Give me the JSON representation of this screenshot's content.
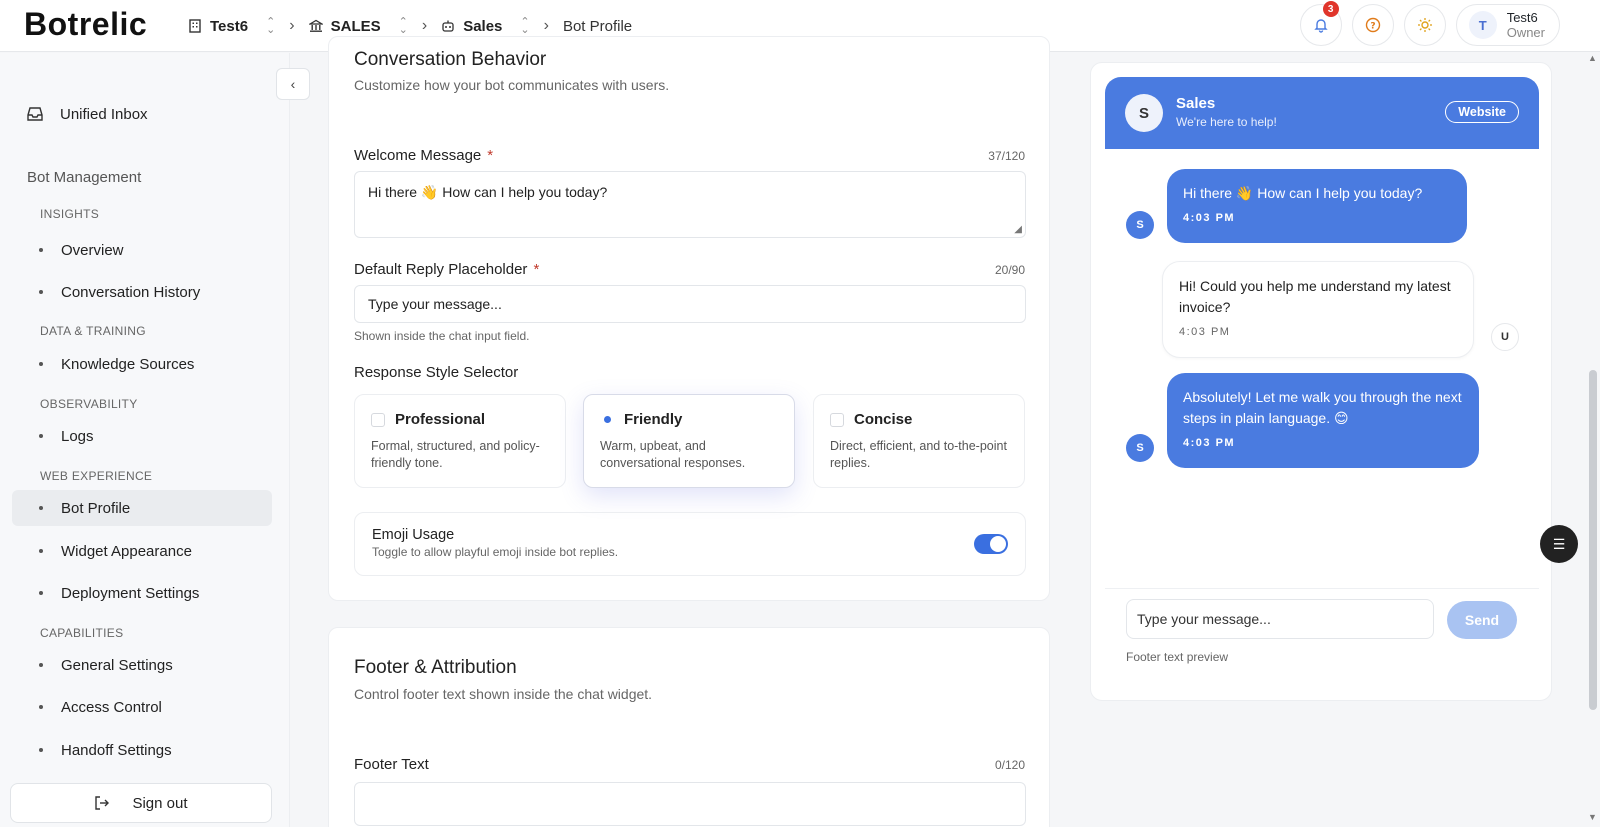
{
  "app": {
    "logo": "Botrelic"
  },
  "breadcrumb": {
    "items": [
      {
        "label": "Test6"
      },
      {
        "label": "SALES"
      },
      {
        "label": "Sales"
      }
    ],
    "current": "Bot Profile"
  },
  "header": {
    "notifications_count": "3",
    "user": {
      "initial": "T",
      "name": "Test6",
      "role": "Owner"
    }
  },
  "sidebar": {
    "inbox": "Unified Inbox",
    "group": "Bot Management",
    "sections": {
      "insights": "INSIGHTS",
      "data": "DATA & TRAINING",
      "observability": "OBSERVABILITY",
      "web": "WEB EXPERIENCE",
      "capabilities": "CAPABILITIES"
    },
    "items": {
      "overview": "Overview",
      "history": "Conversation History",
      "knowledge": "Knowledge Sources",
      "logs": "Logs",
      "bot_profile": "Bot Profile",
      "widget": "Widget Appearance",
      "deployment": "Deployment Settings",
      "general": "General Settings",
      "access": "Access Control",
      "handoff": "Handoff Settings"
    },
    "signout": "Sign out"
  },
  "behavior": {
    "title": "Conversation Behavior",
    "subtitle": "Customize how your bot communicates with users.",
    "welcome_label": "Welcome Message",
    "welcome_counter": "37/120",
    "welcome_value": "Hi there 👋 How can I help you today?",
    "placeholder_label": "Default Reply Placeholder",
    "placeholder_counter": "20/90",
    "placeholder_value": "Type your message...",
    "placeholder_helper": "Shown inside the chat input field.",
    "style_label": "Response Style Selector",
    "styles": [
      {
        "name": "Professional",
        "desc": "Formal, structured, and policy-friendly tone."
      },
      {
        "name": "Friendly",
        "desc": "Warm, upbeat, and conversational responses."
      },
      {
        "name": "Concise",
        "desc": "Direct, efficient, and to-the-point replies."
      }
    ],
    "emoji_title": "Emoji Usage",
    "emoji_desc": "Toggle to allow playful emoji inside bot replies."
  },
  "footer_section": {
    "title": "Footer & Attribution",
    "subtitle": "Control footer text shown inside the chat widget.",
    "footer_label": "Footer Text",
    "footer_counter": "0/120"
  },
  "preview": {
    "avatar": "S",
    "name": "Sales",
    "subtitle": "We're here to help!",
    "pill": "Website",
    "messages": [
      {
        "text": "Hi there 👋 How can I help you today?",
        "time": "4:03 PM"
      },
      {
        "text": "Hi! Could you help me understand my latest invoice?",
        "time": "4:03 PM"
      },
      {
        "text": "Absolutely! Let me walk you through the next steps in plain language. 😊",
        "time": "4:03 PM"
      }
    ],
    "bot_avatar": "S",
    "user_avatar": "U",
    "input_placeholder": "Type your message...",
    "send": "Send",
    "footer": "Footer text preview"
  },
  "colors": {
    "accent": "#4a7be0",
    "danger": "#e0352b"
  }
}
